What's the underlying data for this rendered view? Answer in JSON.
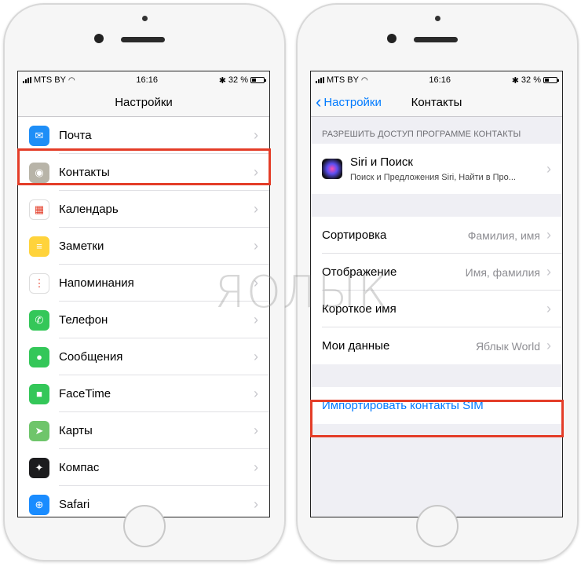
{
  "status": {
    "carrier": "MTS BY",
    "time": "16:16",
    "battery": "32 %"
  },
  "left_screen": {
    "title": "Настройки",
    "items": [
      {
        "label": "Почта",
        "icon": "mail-icon",
        "color": "#1e8ef7",
        "glyph": "✉"
      },
      {
        "label": "Контакты",
        "icon": "contacts-icon",
        "color": "#b8b4a8",
        "glyph": "◉"
      },
      {
        "label": "Календарь",
        "icon": "calendar-icon",
        "color": "#ffffff",
        "glyph": "▦"
      },
      {
        "label": "Заметки",
        "icon": "notes-icon",
        "color": "#ffd33b",
        "glyph": "≡"
      },
      {
        "label": "Напоминания",
        "icon": "reminders-icon",
        "color": "#ffffff",
        "glyph": "⋮"
      },
      {
        "label": "Телефон",
        "icon": "phone-icon",
        "color": "#34c759",
        "glyph": "✆"
      },
      {
        "label": "Сообщения",
        "icon": "messages-icon",
        "color": "#34c759",
        "glyph": "●"
      },
      {
        "label": "FaceTime",
        "icon": "facetime-icon",
        "color": "#34c759",
        "glyph": "■"
      },
      {
        "label": "Карты",
        "icon": "maps-icon",
        "color": "#6fc56b",
        "glyph": "➤"
      },
      {
        "label": "Компас",
        "icon": "compass-icon",
        "color": "#1c1c1e",
        "glyph": "✦"
      },
      {
        "label": "Safari",
        "icon": "safari-icon",
        "color": "#1a8cff",
        "glyph": "⊕"
      }
    ]
  },
  "right_screen": {
    "back_label": "Настройки",
    "title": "Контакты",
    "section_header": "РАЗРЕШИТЬ ДОСТУП ПРОГРАММЕ КОНТАКТЫ",
    "siri": {
      "title": "Siri и Поиск",
      "subtitle": "Поиск и Предложения Siri, Найти в Про..."
    },
    "settings": [
      {
        "label": "Сортировка",
        "value": "Фамилия, имя"
      },
      {
        "label": "Отображение",
        "value": "Имя, фамилия"
      },
      {
        "label": "Короткое имя",
        "value": ""
      },
      {
        "label": "Мои данные",
        "value": "Яблык World"
      }
    ],
    "import_label": "Импортировать контакты SIM"
  },
  "watermark": "ЯОЛЫК",
  "colors": {
    "highlight": "#e43d28",
    "ios_blue": "#007aff"
  }
}
